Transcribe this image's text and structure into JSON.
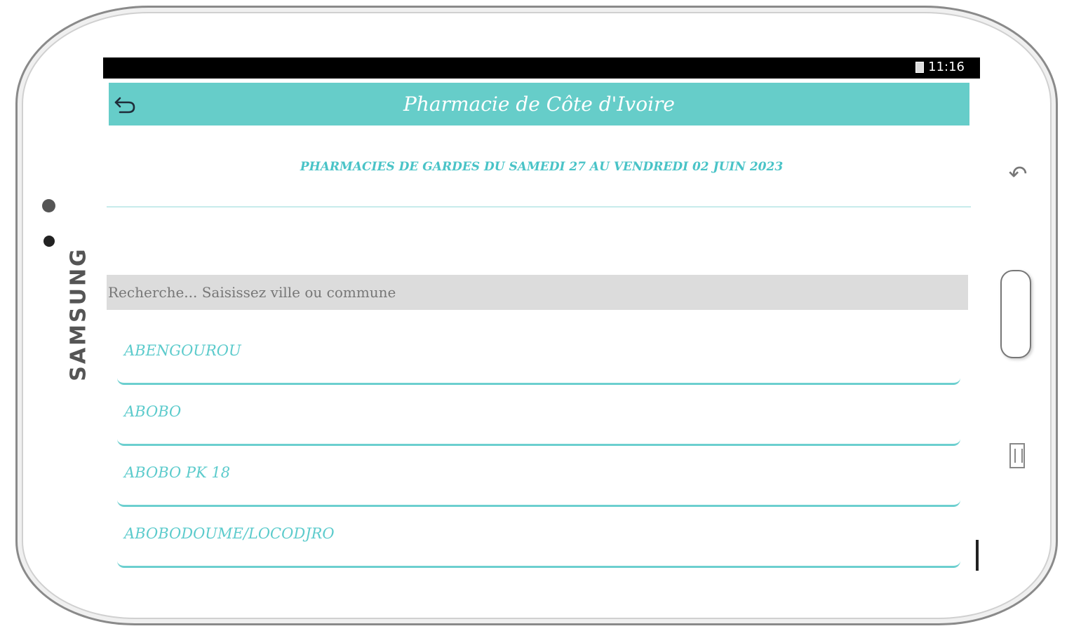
{
  "device": {
    "brand": "SAMSUNG"
  },
  "status_bar": {
    "time": "11:16"
  },
  "app_bar": {
    "title": "Pharmacie de Côte d'Ivoire"
  },
  "guard_title": "PHARMACIES DE GARDES DU SAMEDI 27 AU VENDREDI 02 JUIN 2023",
  "search": {
    "placeholder": "Recherche... Saisissez ville ou commune",
    "value": ""
  },
  "communes": [
    {
      "label": "ABENGOUROU"
    },
    {
      "label": "ABOBO"
    },
    {
      "label": "ABOBO PK 18"
    },
    {
      "label": "ABOBODOUME/LOCODJRO"
    }
  ],
  "colors": {
    "accent": "#66cdc9",
    "text_accent": "#49c3c7",
    "search_bg": "#dcdcdc"
  }
}
